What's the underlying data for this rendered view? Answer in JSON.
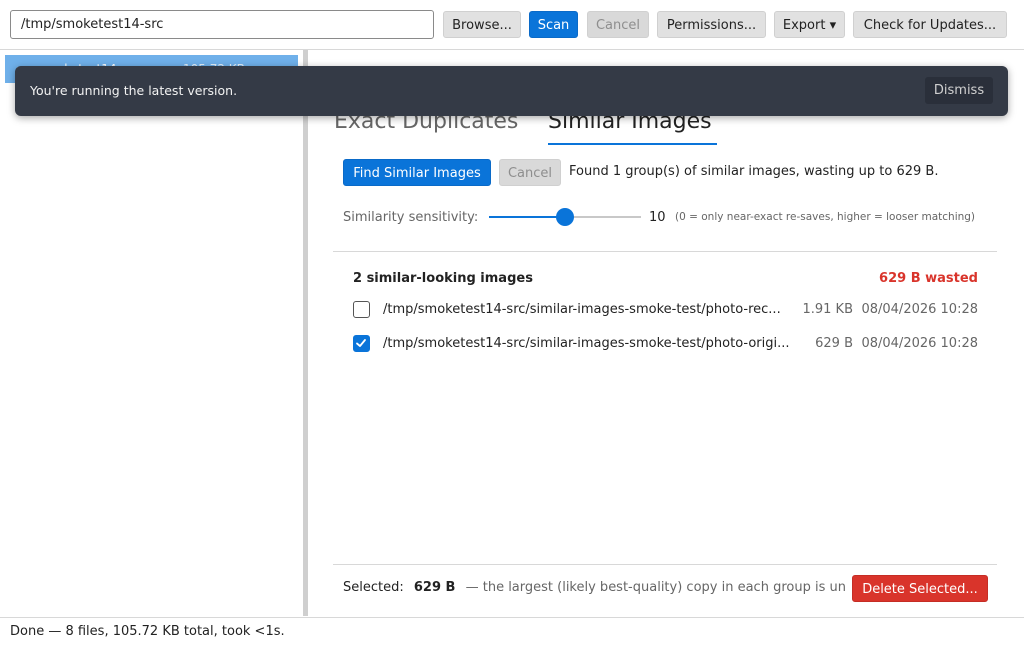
{
  "toolbar": {
    "path_value": "/tmp/smoketest14-src",
    "browse_label": "Browse...",
    "scan_label": "Scan",
    "cancel_label": "Cancel",
    "permissions_label": "Permissions...",
    "export_label": "Export ▾",
    "updates_label": "Check for Updates..."
  },
  "sidebar": {
    "tree_item_name": "smoketest14-src",
    "tree_item_size": "105.72 KB"
  },
  "toast": {
    "message": "You're running the latest version.",
    "dismiss_label": "Dismiss"
  },
  "tabs": {
    "exact": "Exact Duplicates",
    "similar": "Similar Images"
  },
  "similar": {
    "find_label": "Find Similar Images",
    "cancel_label": "Cancel",
    "result_text": "Found 1 group(s) of similar images, wasting up to 629 B.",
    "sensitivity_label": "Similarity sensitivity:",
    "sensitivity_value": "10",
    "sensitivity_fraction": 0.5,
    "sensitivity_hint": "(0 = only near-exact re-saves, higher = looser matching)"
  },
  "group": {
    "title": "2 similar-looking images",
    "wasted": "629 B wasted",
    "files": [
      {
        "path": "/tmp/smoketest14-src/similar-images-smoke-test/photo-rec...",
        "size": "1.91 KB",
        "date": "08/04/2026 10:28",
        "checked": false
      },
      {
        "path": "/tmp/smoketest14-src/similar-images-smoke-test/photo-origi...",
        "size": "629 B",
        "date": "08/04/2026 10:28",
        "checked": true
      }
    ]
  },
  "footer": {
    "selected_label": "Selected:",
    "selected_size": "629 B",
    "note": "— the largest (likely best-quality) copy in each group is un",
    "delete_label": "Delete Selected..."
  },
  "status": {
    "text": "Done — 8 files, 105.72 KB total, took <1s."
  },
  "colors": {
    "accent": "#0a74d9",
    "danger": "#d9342b",
    "toast_bg": "#343a46"
  }
}
